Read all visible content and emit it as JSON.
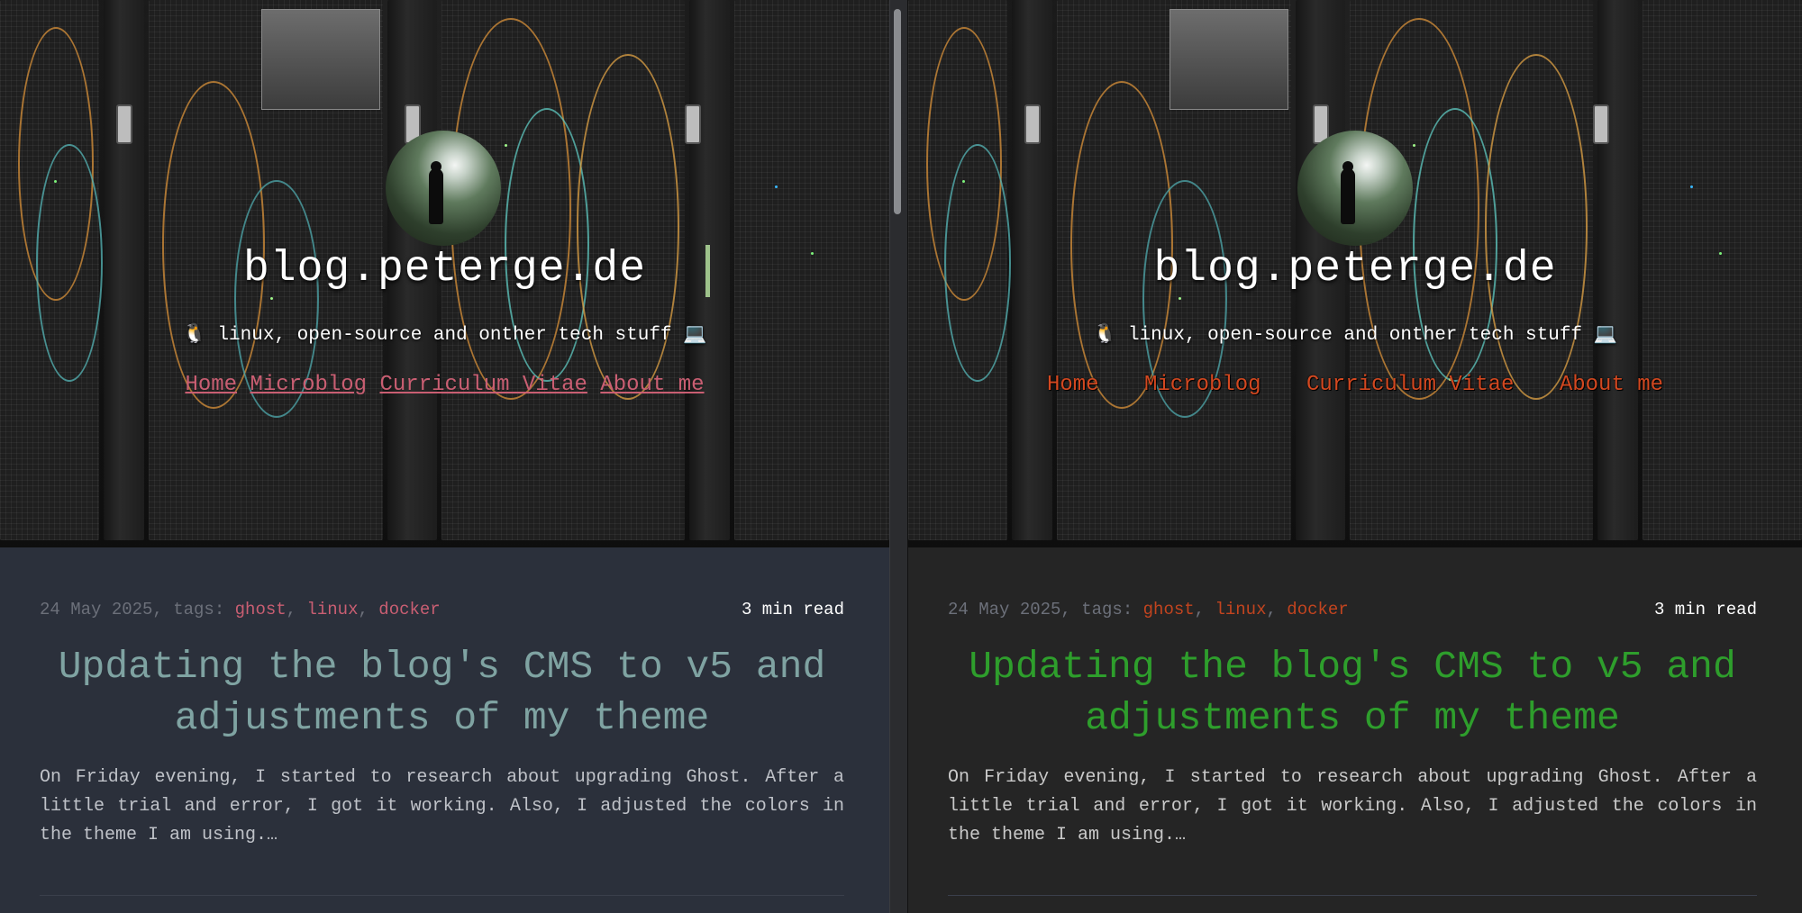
{
  "site": {
    "title": "blog.peterge.de",
    "tagline": "linux, open-source and onther tech stuff"
  },
  "nav": [
    "Home",
    "Microblog",
    "Curriculum Vitae",
    "About me"
  ],
  "post": {
    "date": "24 May 2025, tags: ",
    "tags": [
      "ghost",
      "linux",
      "docker"
    ],
    "read_time": "3 min read",
    "title": "Updating the blog's CMS to v5 and adjustments of my theme",
    "excerpt": "On Friday evening, I started to research about upgrading Ghost. After a little trial and error, I got it working. Also, I adjusted the colors in the theme I am using.…"
  },
  "icons": {
    "tagline_left": "penguin-icon",
    "tagline_right": "laptop-icon"
  },
  "colors": {
    "left_link": "#c95e72",
    "right_link": "#d34820",
    "left_title": "#7fa3a2",
    "right_title": "#2e9e2c",
    "left_bg": "#2b303b",
    "right_bg": "#252525"
  }
}
